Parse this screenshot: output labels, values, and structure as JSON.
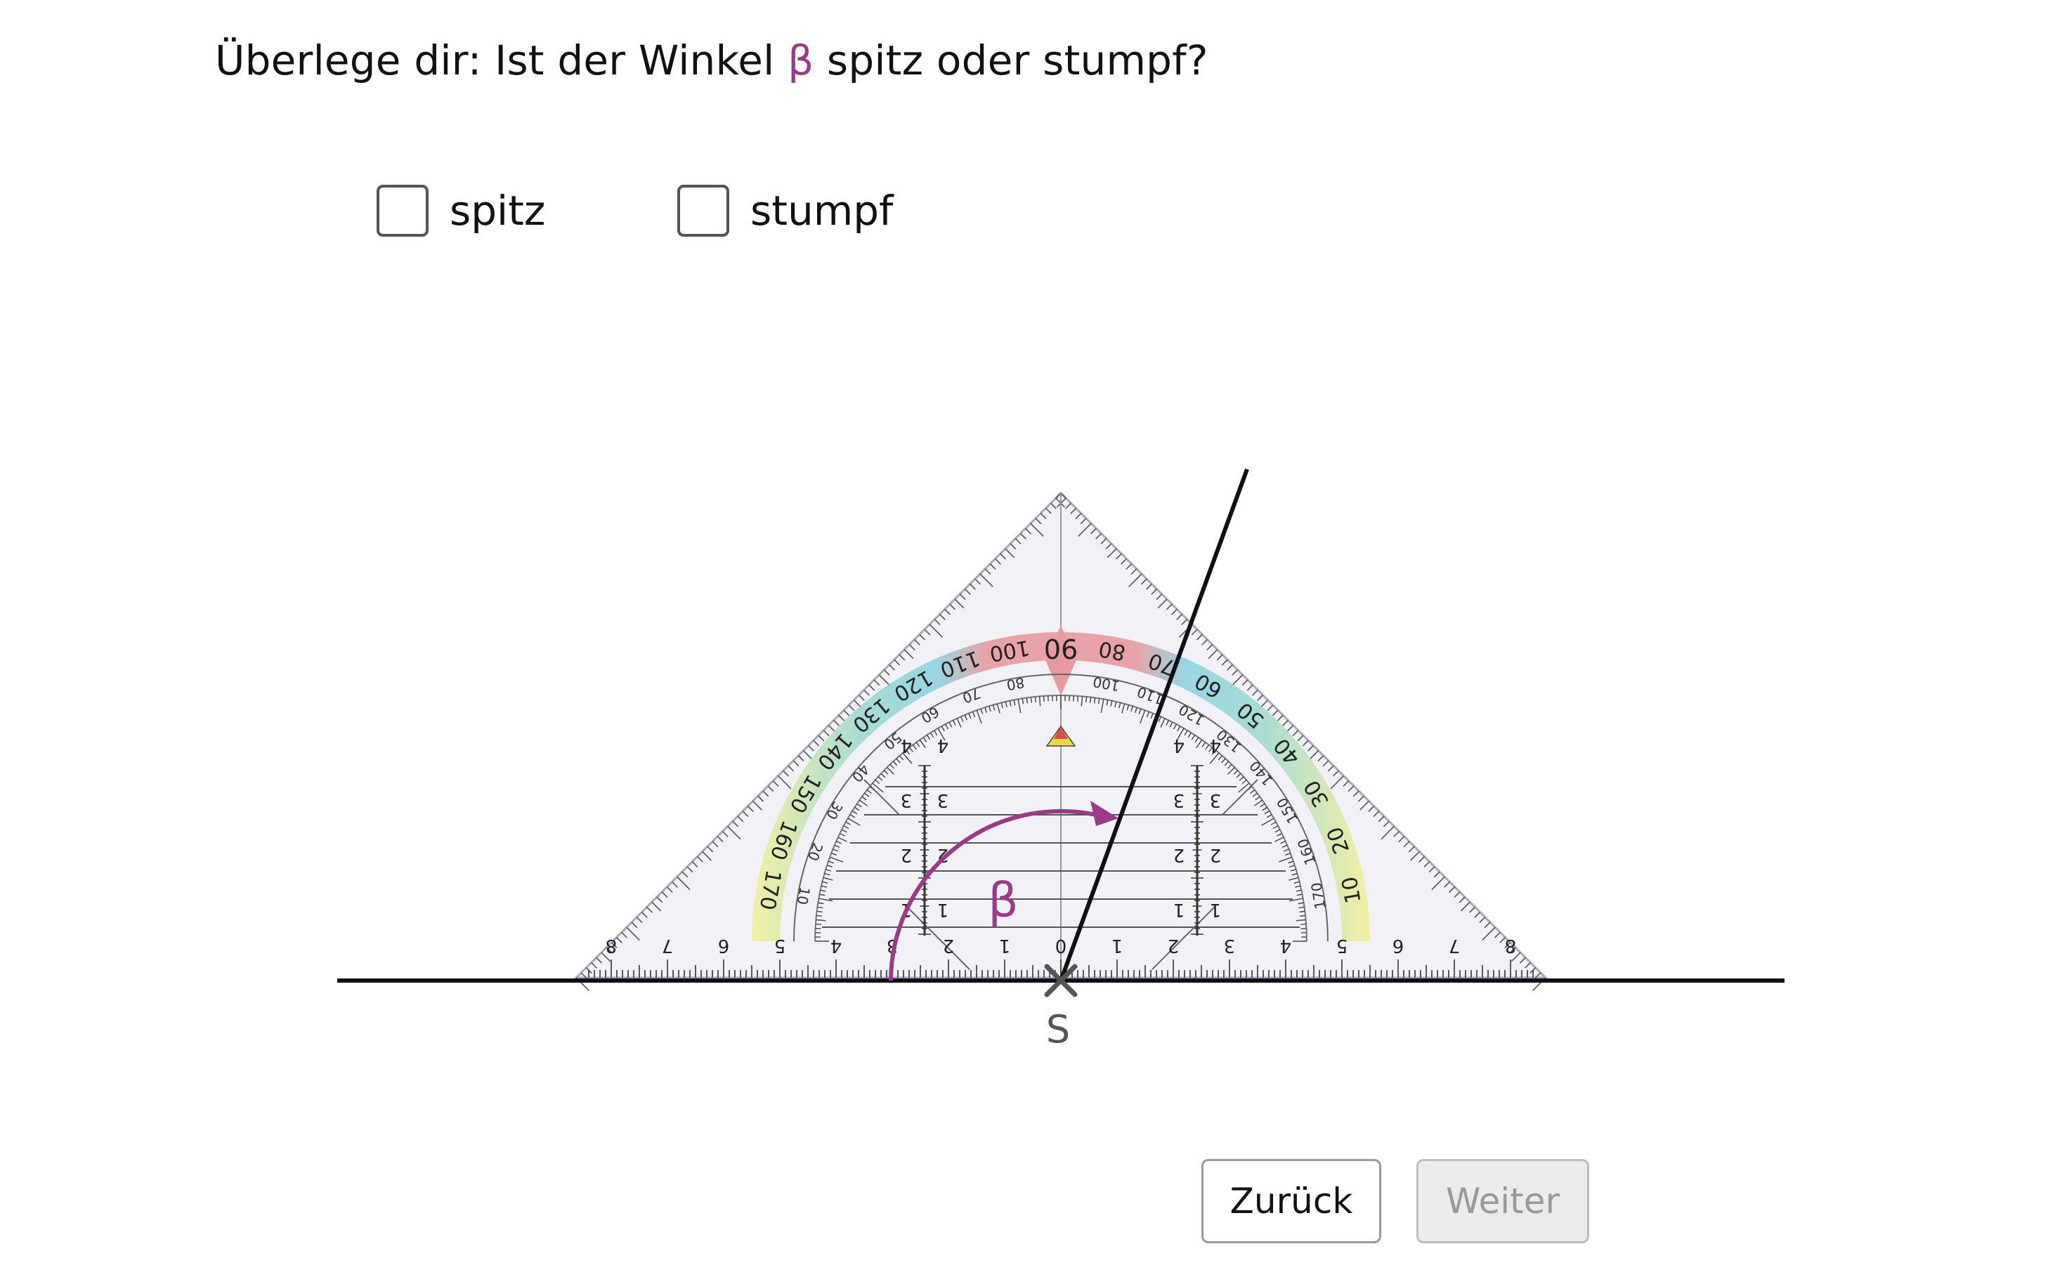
{
  "question": {
    "prefix": "Überlege dir: Ist der Winkel ",
    "symbol": "β",
    "suffix": " spitz oder stumpf?"
  },
  "options": [
    {
      "label": "spitz",
      "checked": false
    },
    {
      "label": "stumpf",
      "checked": false
    }
  ],
  "figure": {
    "vertex_label": "S",
    "angle_label": "β",
    "angle_color": "#9b3b87",
    "protractor": {
      "outer_scale": [
        10,
        20,
        30,
        40,
        50,
        60,
        70,
        80,
        90,
        100,
        110,
        120,
        130,
        140,
        150,
        160,
        170
      ],
      "inner_scale": [
        170,
        160,
        150,
        140,
        130,
        120,
        110,
        100,
        80,
        70,
        60,
        50,
        40,
        30,
        20,
        10
      ],
      "base_scale": [
        8,
        7,
        6,
        5,
        4,
        3,
        2,
        1,
        0,
        1,
        2,
        3,
        4,
        5,
        6,
        7,
        8
      ],
      "vertical_scale": [
        1,
        2,
        3,
        4
      ]
    }
  },
  "buttons": {
    "back": "Zurück",
    "next": "Weiter"
  }
}
